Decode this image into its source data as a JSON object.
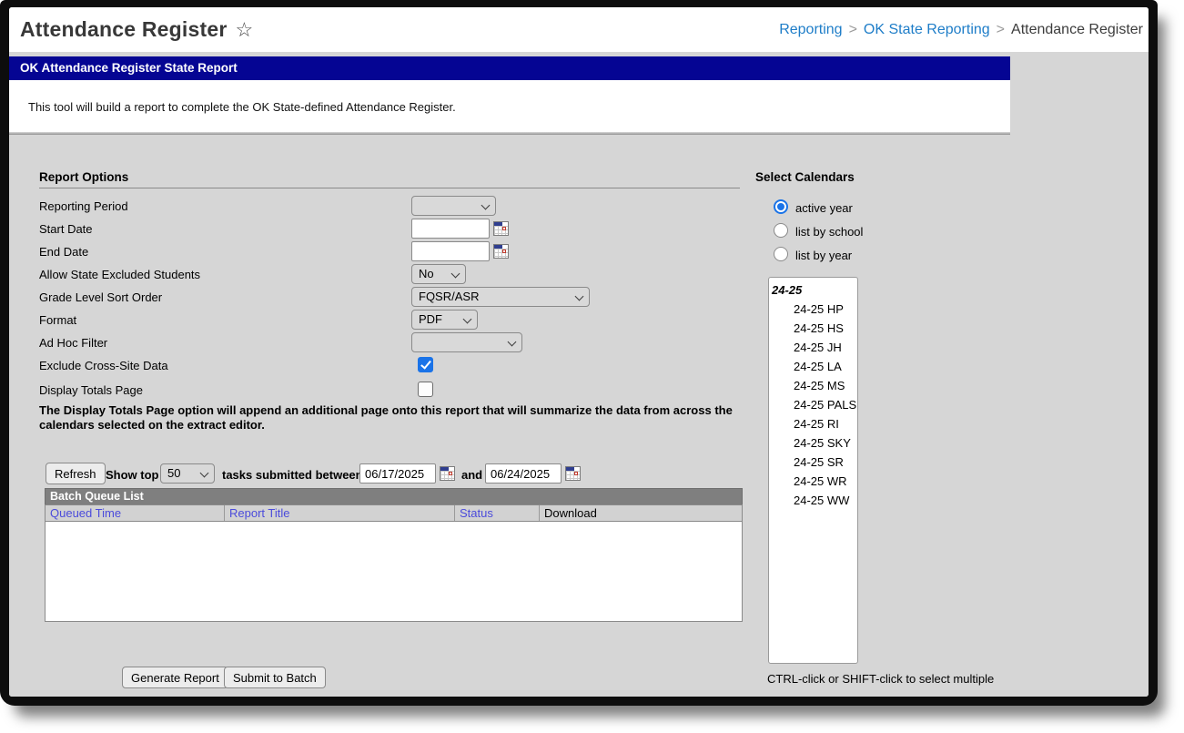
{
  "header": {
    "title": "Attendance Register",
    "favorite_glyph": "☆",
    "breadcrumb": {
      "separator": ">",
      "items": [
        "Reporting",
        "OK State Reporting",
        "Attendance Register"
      ]
    }
  },
  "report": {
    "bar_title": "OK Attendance Register State Report",
    "description": "This tool will build a report to complete the OK State-defined Attendance Register."
  },
  "options": {
    "section_title": "Report Options",
    "fields": [
      {
        "label": "Reporting Period",
        "type": "select",
        "value": ""
      },
      {
        "label": "Start Date",
        "type": "date",
        "value": ""
      },
      {
        "label": "End Date",
        "type": "date",
        "value": ""
      },
      {
        "label": "Allow State Excluded Students",
        "type": "select",
        "value": "No"
      },
      {
        "label": "Grade Level Sort Order",
        "type": "select",
        "value": "FQSR/ASR"
      },
      {
        "label": "Format",
        "type": "select",
        "value": "PDF"
      },
      {
        "label": "Ad Hoc Filter",
        "type": "select",
        "value": ""
      },
      {
        "label": "Exclude Cross-Site Data",
        "type": "checkbox",
        "checked": true
      },
      {
        "label": "Display Totals Page",
        "type": "checkbox",
        "checked": false
      }
    ],
    "note": "The Display Totals Page option will append an additional page onto this report that will summarize the data from across the calendars selected on the extract editor."
  },
  "batch": {
    "refresh_label": "Refresh",
    "show_top_label": "Show top",
    "show_top_value": "50",
    "between_label": "tasks submitted between",
    "start_date": "06/17/2025",
    "and_label": "and",
    "end_date": "06/24/2025",
    "table_title": "Batch Queue List",
    "columns": [
      "Queued Time",
      "Report Title",
      "Status",
      "Download"
    ],
    "rows": []
  },
  "actions": {
    "generate_label": "Generate Report",
    "submit_label": "Submit to Batch"
  },
  "calendars": {
    "section_title": "Select Calendars",
    "radios": [
      {
        "label": "active year",
        "selected": true
      },
      {
        "label": "list by school",
        "selected": false
      },
      {
        "label": "list by year",
        "selected": false
      }
    ],
    "list_group": "24-25",
    "list_items": [
      "24-25 HP",
      "24-25 HS",
      "24-25 JH",
      "24-25 LA",
      "24-25 MS",
      "24-25 PALS",
      "24-25 RI",
      "24-25 SKY",
      "24-25 SR",
      "24-25 WR",
      "24-25 WW"
    ],
    "helper": "CTRL-click or SHIFT-click to select multiple"
  },
  "colors": {
    "navy_bar": "#050593",
    "page_background": "#d6d6d6",
    "breadcrumb_link": "#1e7dc8",
    "table_header_link": "#4b4bdb",
    "table_title_bar": "#7f7f7f",
    "accent_checkbox": "#1a73e8"
  }
}
